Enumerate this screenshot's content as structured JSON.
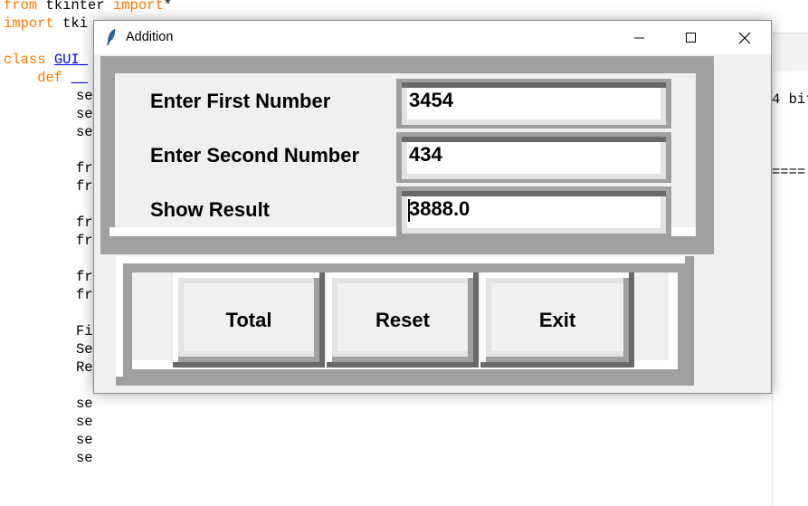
{
  "background_editor": {
    "lines": [
      {
        "parts": [
          {
            "t": "from",
            "c": "kw"
          },
          {
            "t": " tkinter ",
            "c": ""
          },
          {
            "t": "import",
            "c": "kw"
          },
          {
            "t": "*",
            "c": ""
          }
        ]
      },
      {
        "parts": [
          {
            "t": "import",
            "c": "kw"
          },
          {
            "t": " tki",
            "c": ""
          }
        ]
      },
      {
        "parts": []
      },
      {
        "parts": [
          {
            "t": "class",
            "c": "kw"
          },
          {
            "t": " ",
            "c": ""
          },
          {
            "t": "GUI_",
            "c": "cls"
          }
        ]
      },
      {
        "parts": [
          {
            "t": "    def",
            "c": "kw"
          },
          {
            "t": " ",
            "c": ""
          },
          {
            "t": "__",
            "c": "cls"
          }
        ]
      }
    ],
    "fragments": [
      "se",
      "se",
      "se",
      "",
      "fr",
      "fr",
      "",
      "fr",
      "fr",
      "",
      "fr",
      "fr",
      "",
      "Fi",
      "Se",
      "Re",
      "",
      "se",
      "se",
      "se",
      "se"
    ],
    "right_fragments": [
      "4 bit",
      "===="
    ]
  },
  "window": {
    "title": "Addition",
    "controls": {
      "minimize": "minimize-icon",
      "maximize": "maximize-icon",
      "close": "close-icon"
    }
  },
  "form": {
    "labels": [
      "Enter First Number",
      "Enter Second Number",
      "Show Result"
    ],
    "entries": [
      {
        "name": "first-number-input",
        "value": "3454"
      },
      {
        "name": "second-number-input",
        "value": "434"
      },
      {
        "name": "result-output",
        "value": "3888.0"
      }
    ]
  },
  "buttons": [
    {
      "name": "total-button",
      "label": "Total"
    },
    {
      "name": "reset-button",
      "label": "Reset"
    },
    {
      "name": "exit-button",
      "label": "Exit"
    }
  ]
}
